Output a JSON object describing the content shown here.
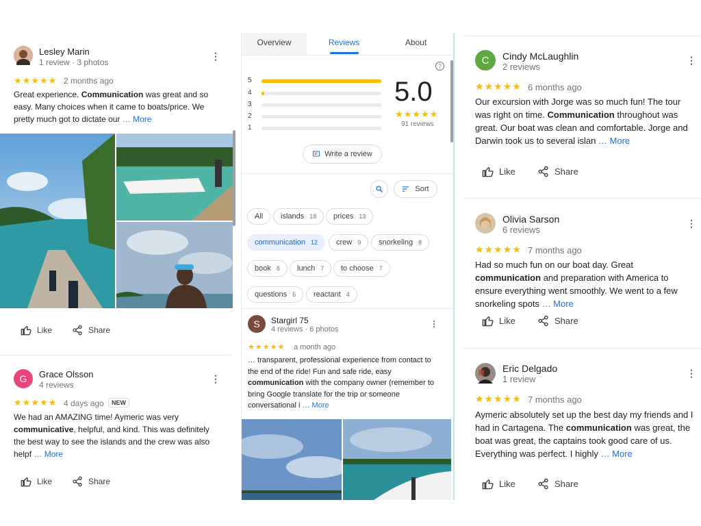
{
  "left": {
    "review1": {
      "name": "Lesley Marin",
      "meta": "1 review · 3 photos",
      "stars": "★★★★★",
      "date": "2 months ago",
      "text_a": "Great experience. ",
      "text_bold": "Communication",
      "text_b": " was great and so easy. Many choices when it came to boats/price. We pretty much got to dictate our ",
      "more": "… More",
      "like": "Like",
      "share": "Share"
    },
    "review2": {
      "initial": "G",
      "name": "Grace Olsson",
      "meta": "4 reviews",
      "stars": "★★★★★",
      "date": "4 days ago",
      "badge": "NEW",
      "text_a": "We had an AMAZING time! Aymeric was very ",
      "text_bold": "communicative",
      "text_b": ", helpful, and kind. This was definitely the best way to see the islands and the crew was also helpf ",
      "more": "… More",
      "like": "Like",
      "share": "Share"
    }
  },
  "middle": {
    "tabs": [
      "Overview",
      "Reviews",
      "About"
    ],
    "rating": "5.0",
    "rating_stars": "★★★★★",
    "review_count": "91 reviews",
    "bars": [
      {
        "label": "5",
        "fill": 1.0
      },
      {
        "label": "4",
        "fill": 0.02
      },
      {
        "label": "3",
        "fill": 0.0
      },
      {
        "label": "2",
        "fill": 0.0
      },
      {
        "label": "1",
        "fill": 0.0
      }
    ],
    "write_review": "Write a review",
    "sort": "Sort",
    "chips": [
      {
        "label": "All",
        "count": ""
      },
      {
        "label": "islands",
        "count": "18"
      },
      {
        "label": "prices",
        "count": "13"
      },
      {
        "label": "communication",
        "count": "12"
      },
      {
        "label": "crew",
        "count": "9"
      },
      {
        "label": "snorkeling",
        "count": "8"
      },
      {
        "label": "book",
        "count": "8"
      },
      {
        "label": "lunch",
        "count": "7"
      },
      {
        "label": "to choose",
        "count": "7"
      },
      {
        "label": "questions",
        "count": "6"
      },
      {
        "label": "reactant",
        "count": "4"
      }
    ],
    "review": {
      "initial": "S",
      "name": "Stargirl 75",
      "meta": "4 reviews · 6 photos",
      "stars": "★★★★★",
      "date": "a month ago",
      "text_a": "… transparent, professional experience from contact to the end of the ride!  Fun and safe ride, easy ",
      "text_bold": "communication",
      "text_b": " with the company owner (remember to bring Google translate for the trip or someone conversational i ",
      "more": "… More"
    }
  },
  "right": {
    "review1": {
      "initial": "C",
      "name": "Cindy McLaughlin",
      "meta": "2 reviews",
      "stars": "★★★★★",
      "date": "6 months ago",
      "text_a": "Our excursion with Jorge was  so much fun!  The tour was right on time. ",
      "text_bold": "Communication",
      "text_b": " throughout was great. Our boat was clean and comfortable. Jorge and Darwin took us to several islan ",
      "more": "… More",
      "like": "Like",
      "share": "Share"
    },
    "review2": {
      "name": "Olivia Sarson",
      "meta": "6 reviews",
      "stars": "★★★★★",
      "date": "7 months ago",
      "text_a": "Had so much fun on our boat day. Great ",
      "text_bold": "communication",
      "text_b": " and preparation with America to ensure everything went smoothly. We went to a few snorkeling spots ",
      "more": "… More",
      "like": "Like",
      "share": "Share"
    },
    "review3": {
      "name": "Eric Delgado",
      "meta": "1 review",
      "stars": "★★★★★",
      "date": "7 months ago",
      "text_a": "Aymeric absolutely set up the best day my friends and I had in Cartagena. The ",
      "text_bold": "communication",
      "text_b": " was great, the boat was great, the captains took good care of us. Everything was perfect. I highly ",
      "more": "… More",
      "like": "Like",
      "share": "Share"
    }
  },
  "colors": {
    "star": "#fbbc04",
    "link": "#1a73e8",
    "chip_selected_bg": "#e8f0fe",
    "avatar_grace": "#e8457a",
    "avatar_cindy": "#5fa843",
    "avatar_stargirl": "#7b4a3a"
  }
}
